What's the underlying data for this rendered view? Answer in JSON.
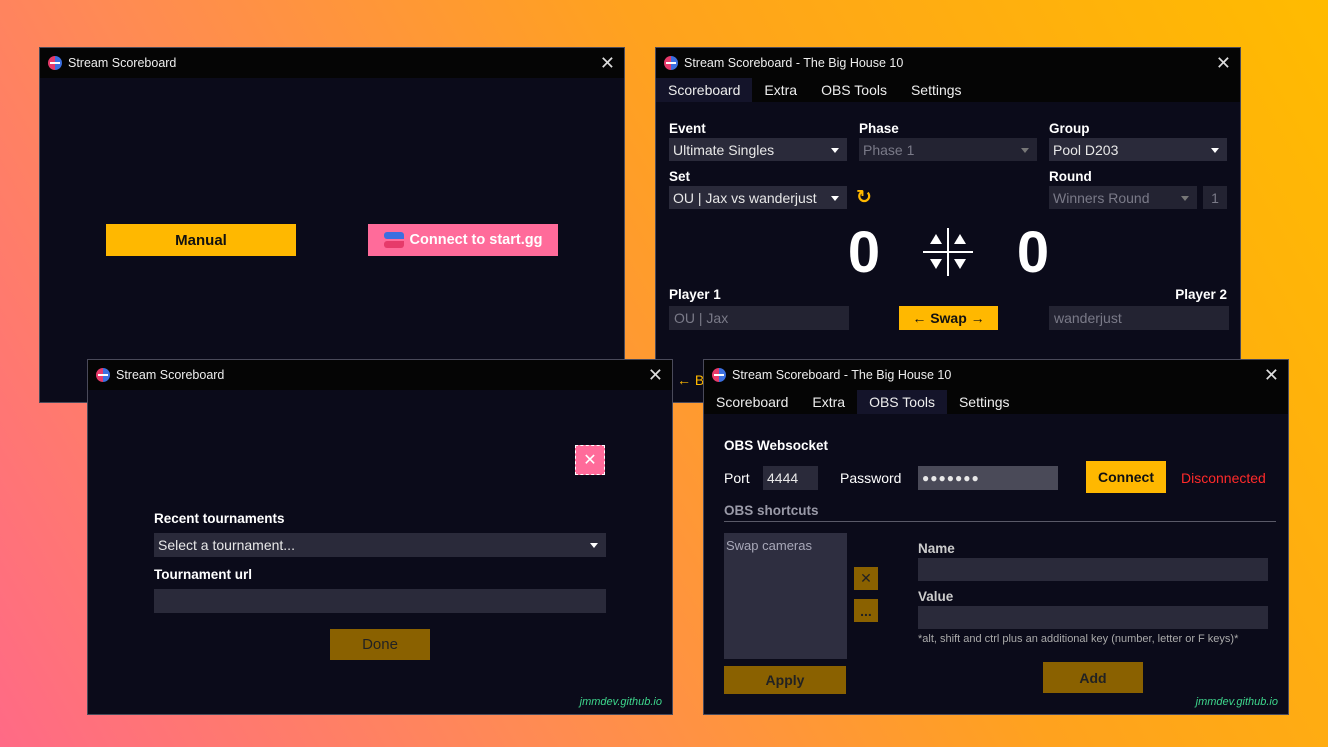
{
  "win1": {
    "title": "Stream Scoreboard",
    "manual_button": "Manual",
    "startgg_button": "Connect to start.gg"
  },
  "win2": {
    "title": "Stream Scoreboard - The Big House 10",
    "tabs": [
      "Scoreboard",
      "Extra",
      "OBS Tools",
      "Settings"
    ],
    "event_label": "Event",
    "event_value": "Ultimate Singles",
    "phase_label": "Phase",
    "phase_value": "Phase 1",
    "group_label": "Group",
    "group_value": "Pool D203",
    "set_label": "Set",
    "set_value": "OU | Jax vs wanderjust",
    "round_label": "Round",
    "round_value": "Winners Round",
    "round_number": "1",
    "score_left": "0",
    "score_right": "0",
    "player1_label": "Player 1",
    "player2_label": "Player 2",
    "player1_value": "OU | Jax",
    "player2_value": "wanderjust",
    "swap_button": "← Swap →",
    "peek_text": "← B"
  },
  "win3": {
    "title": "Stream Scoreboard",
    "recent_label": "Recent tournaments",
    "recent_value": "Select a tournament...",
    "url_label": "Tournament url",
    "url_value": "",
    "done_button": "Done",
    "footer": "jmmdev.github.io"
  },
  "win4": {
    "title": "Stream Scoreboard - The Big House 10",
    "tabs": [
      "Scoreboard",
      "Extra",
      "OBS Tools",
      "Settings"
    ],
    "ws_heading": "OBS Websocket",
    "port_label": "Port",
    "port_value": "4444",
    "password_label": "Password",
    "password_value": "●●●●●●●",
    "connect_button": "Connect",
    "status": "Disconnected",
    "shortcuts_heading": "OBS shortcuts",
    "shortcut_items": [
      "Swap cameras"
    ],
    "remove_button": "✕",
    "more_button": "...",
    "name_label": "Name",
    "value_label": "Value",
    "hint": "*alt, shift and ctrl plus an additional key (number, letter or F keys)*",
    "apply_button": "Apply",
    "add_button": "Add",
    "footer": "jmmdev.github.io"
  },
  "colors": {
    "accent": "#ffb800",
    "accent_dim": "#8a6100",
    "startgg": "#ff6b9a",
    "status_error": "#ff2a2a",
    "footer_link": "#3dd68c"
  }
}
